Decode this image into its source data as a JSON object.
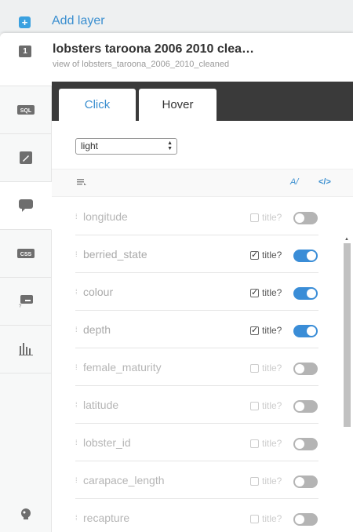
{
  "add_layer": {
    "label": "Add layer",
    "icon": "plus-icon",
    "accent": "#3aa1e0"
  },
  "layer": {
    "number": "1",
    "title": "lobsters taroona 2006 2010 clea…",
    "subtitle": "view of lobsters_taroona_2006_2010_cleaned"
  },
  "rail": {
    "items": [
      {
        "name": "sql",
        "icon": "sql-icon"
      },
      {
        "name": "wizard",
        "icon": "brush-icon"
      },
      {
        "name": "infowindow",
        "icon": "speech-bubble-icon",
        "active": true
      },
      {
        "name": "css",
        "icon": "css-icon"
      },
      {
        "name": "legend",
        "icon": "legend-icon"
      },
      {
        "name": "filters",
        "icon": "bar-chart-icon"
      }
    ],
    "bottom_icon": "lightbulb-icon"
  },
  "tabs": {
    "click": "Click",
    "hover": "Hover",
    "active": "hover"
  },
  "theme_select": {
    "value": "light"
  },
  "toolbar": {
    "az_label": "A/",
    "code_label": "</>"
  },
  "fields": [
    {
      "name": "longitude",
      "title_label": "title?",
      "enabled": false
    },
    {
      "name": "berried_state",
      "title_label": "title?",
      "enabled": true
    },
    {
      "name": "colour",
      "title_label": "title?",
      "enabled": true
    },
    {
      "name": "depth",
      "title_label": "title?",
      "enabled": true
    },
    {
      "name": "female_maturity",
      "title_label": "title?",
      "enabled": false
    },
    {
      "name": "latitude",
      "title_label": "title?",
      "enabled": false
    },
    {
      "name": "lobster_id",
      "title_label": "title?",
      "enabled": false
    },
    {
      "name": "carapace_length",
      "title_label": "title?",
      "enabled": false
    },
    {
      "name": "recapture",
      "title_label": "title?",
      "enabled": false
    }
  ],
  "colors": {
    "link_blue": "#3b8fd0",
    "toggle_on": "#3a8dd7",
    "toggle_off": "#b4b4b4",
    "tab_bar": "#3a3a3a"
  }
}
